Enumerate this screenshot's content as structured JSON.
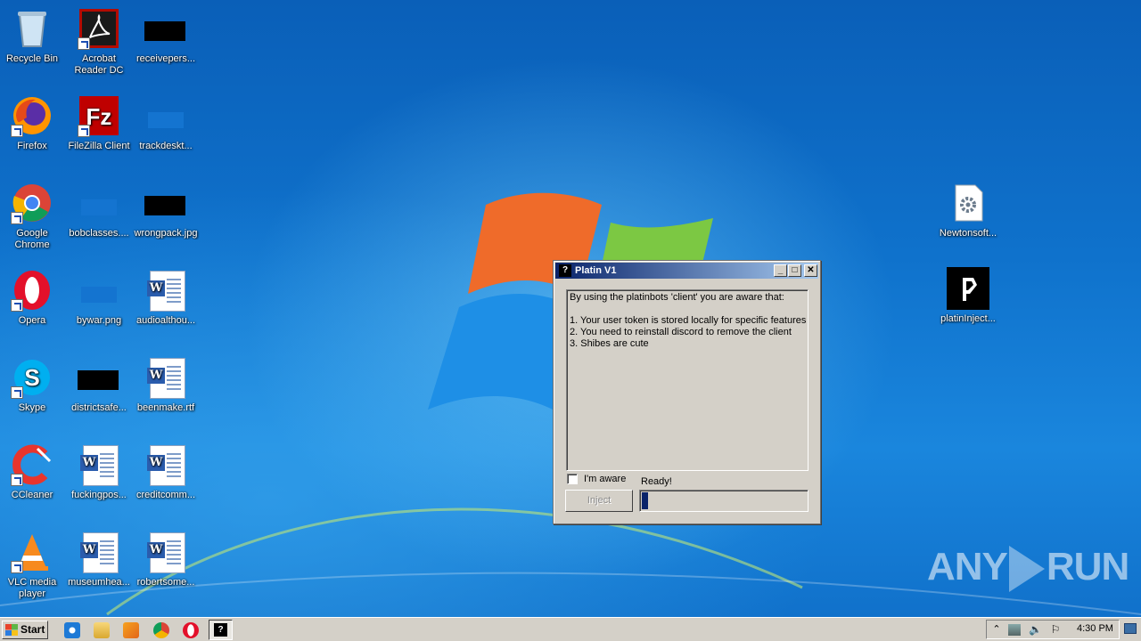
{
  "desktop": {
    "icons": [
      {
        "label": "Recycle Bin",
        "icon": "recycle-bin-icon"
      },
      {
        "label": "Acrobat\nReader DC",
        "label1": "Acrobat",
        "label2": "Reader DC",
        "icon": "acrobat-icon"
      },
      {
        "label": "receivepers...",
        "icon": "black-file-icon"
      },
      {
        "label": "Firefox",
        "icon": "firefox-icon"
      },
      {
        "label": "FileZilla Client",
        "icon": "filezilla-icon"
      },
      {
        "label": "trackdeskt...",
        "icon": "blank-file-icon"
      },
      {
        "label1": "Google",
        "label2": "Chrome",
        "icon": "chrome-icon"
      },
      {
        "label": "bobclasses....",
        "icon": "blank-file-icon"
      },
      {
        "label": "wrongpack.jpg",
        "icon": "black-file-icon"
      },
      {
        "label": "Opera",
        "icon": "opera-icon"
      },
      {
        "label": "bywar.png",
        "icon": "blank-file-icon"
      },
      {
        "label": "audioalthou...",
        "icon": "word-doc-icon"
      },
      {
        "label": "Skype",
        "icon": "skype-icon"
      },
      {
        "label": "districtsafe...",
        "icon": "black-file-icon"
      },
      {
        "label": "beenmake.rtf",
        "icon": "word-doc-icon"
      },
      {
        "label": "CCleaner",
        "icon": "ccleaner-icon"
      },
      {
        "label": "fuckingpos...",
        "icon": "word-doc-icon"
      },
      {
        "label": "creditcomm...",
        "icon": "word-doc-icon"
      },
      {
        "label1": "VLC media",
        "label2": "player",
        "icon": "vlc-icon"
      },
      {
        "label": "museumhea...",
        "icon": "word-doc-icon"
      },
      {
        "label": "robertsome...",
        "icon": "word-doc-icon"
      },
      {
        "label": "Newtonsoft...",
        "icon": "settings-file-icon"
      },
      {
        "label": "platinInject...",
        "icon": "platin-icon"
      }
    ]
  },
  "dialog": {
    "title": "Platin V1",
    "text_lines": [
      "By using the platinbots 'client' you are aware that:",
      "",
      "1. Your user token is stored locally for specific features",
      "2. You need to reinstall discord to remove the client",
      "3. Shibes are cute"
    ],
    "checkbox_label": "I'm aware",
    "checkbox_checked": false,
    "status": "Ready!",
    "inject_label": "Inject",
    "inject_enabled": false,
    "progress_fraction": 0.04
  },
  "taskbar": {
    "start_label": "Start",
    "clock": "4:30 PM"
  },
  "watermark": {
    "left": "ANY",
    "right": "RUN"
  },
  "colors": {
    "title_gradient_start": "#0a246a",
    "title_gradient_end": "#a6caf0",
    "dialog_face": "#d4d0c8",
    "progress_fill": "#0a246a"
  }
}
